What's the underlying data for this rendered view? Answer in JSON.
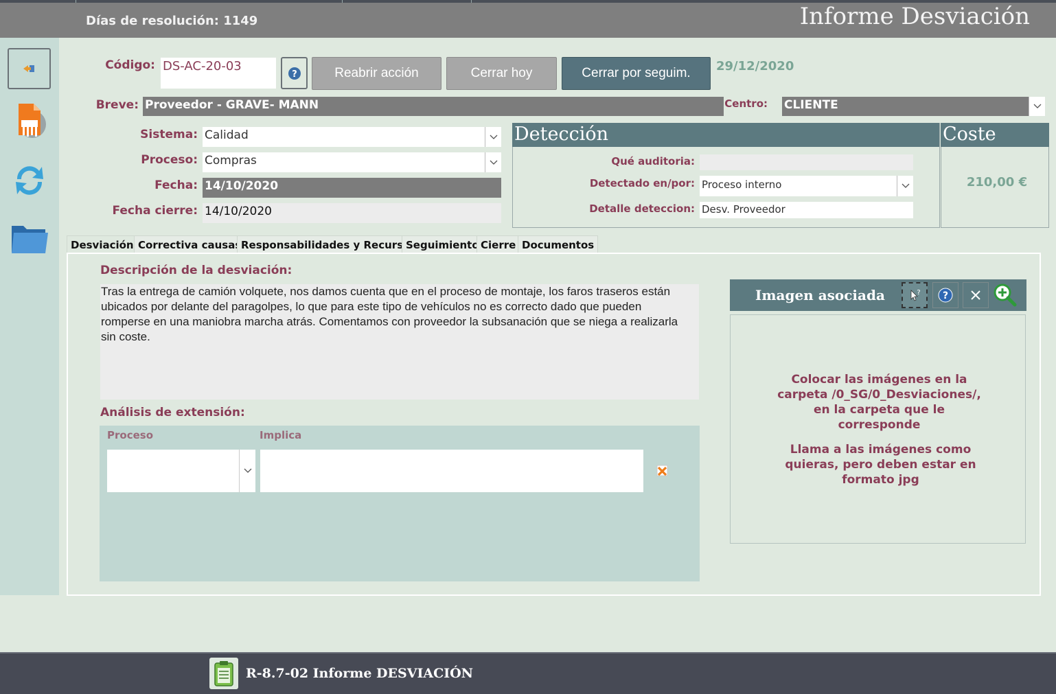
{
  "header": {
    "resolution_label": "Días de resolución: 1149",
    "title": "Informe Desviación"
  },
  "nav": {
    "back_icon": "exit-arrow-icon",
    "pdf_icon": "pdf-document-icon",
    "refresh_icon": "sync-arrows-icon",
    "folder_icon": "folder-icon"
  },
  "form": {
    "codigo_label": "Código:",
    "codigo_value": "DS-AC-20-03",
    "reabrir_label": "Reabrir acción",
    "cerrar_hoy_label": "Cerrar hoy",
    "cerrar_seguim_label": "Cerrar por seguim.",
    "date_value": "29/12/2020",
    "breve_label": "Breve:",
    "breve_value": "Proveedor - GRAVE- MANN",
    "centro_label": "Centro:",
    "centro_value": "CLIENTE",
    "sistema_label": "Sistema:",
    "sistema_value": "Calidad",
    "proceso_label": "Proceso:",
    "proceso_value": "Compras",
    "fecha_label": "Fecha:",
    "fecha_value": "14/10/2020",
    "fecha_cierre_label": "Fecha cierre:",
    "fecha_cierre_value": "14/10/2020"
  },
  "deteccion": {
    "title": "Detección",
    "que_auditoria_label": "Qué auditoria:",
    "que_auditoria_value": "",
    "detectado_label": "Detectado en/por:",
    "detectado_value": "Proceso interno",
    "detalle_label": "Detalle deteccion:",
    "detalle_value": "Desv. Proveedor"
  },
  "coste": {
    "title": "Coste",
    "value": "210,00 €"
  },
  "tabs": [
    {
      "label": "Desviación",
      "active": true
    },
    {
      "label": "Correctiva causas",
      "active": false
    },
    {
      "label": "Responsabilidades y Recursos",
      "active": false
    },
    {
      "label": "Seguimiento",
      "active": false
    },
    {
      "label": "Cierre",
      "active": false
    },
    {
      "label": "Documentos",
      "active": false
    }
  ],
  "desviacion": {
    "descripcion_label": "Descripción de la desviación:",
    "descripcion_text": "Tras la entrega de camión volquete, nos damos cuenta que en el proceso de montaje, los faros traseros están ubicados por delante del paragolpes, lo que para este tipo de vehículos no es correcto dado que pueden romperse en una maniobra marcha atrás. Comentamos con proveedor la subsanación que se niega a realizarla sin coste.",
    "analisis_label": "Análisis de extensión:",
    "col_proceso": "Proceso",
    "col_implica": "Implica",
    "row_proceso_value": "",
    "row_implica_value": ""
  },
  "imagen": {
    "title": "Imagen asociada",
    "note_1": "Colocar las imágenes en la carpeta /0_SG/0_Desviaciones/, en la carpeta que le corresponde",
    "note_2": "Llama a las imágenes como quieras, pero deben estar en formato jpg"
  },
  "footer": {
    "title": "R-8.7-02 Informe DESVIACIÓN"
  },
  "colors": {
    "accent_label": "#8a3d57",
    "panel_head": "#5c7a80",
    "button_dark": "#56737e",
    "date_green": "#7aa595"
  }
}
